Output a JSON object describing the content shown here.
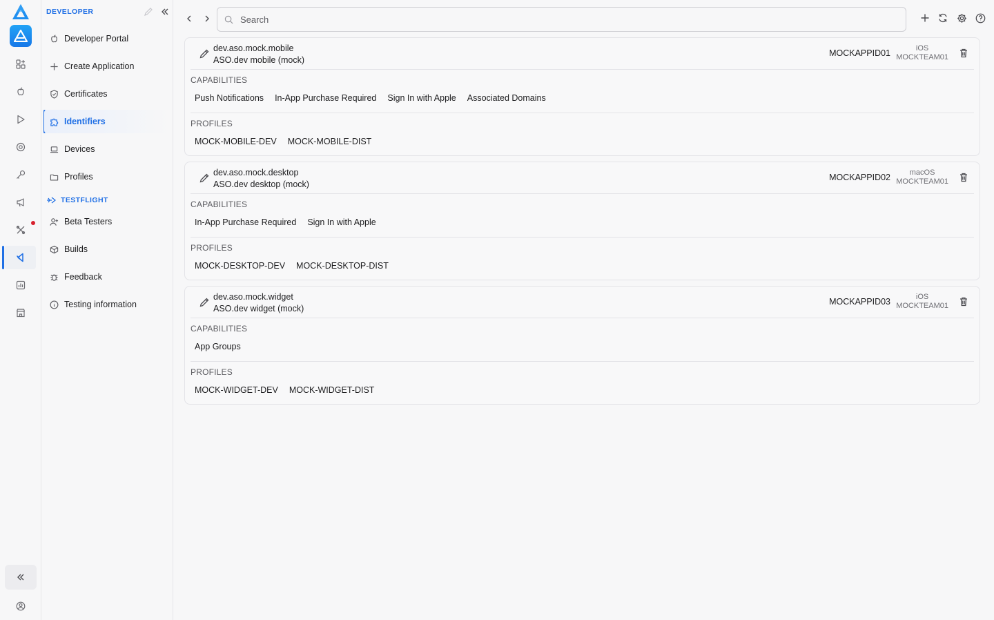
{
  "rail": {
    "icons": [
      "app-grid-icon",
      "apple-icon",
      "play-icon",
      "target-icon",
      "key-icon",
      "megaphone-icon",
      "tools-icon",
      "xcode-icon",
      "analytics-icon",
      "store-icon"
    ],
    "active_index": 7
  },
  "sidebar": {
    "developer_header": "DEVELOPER",
    "items": [
      {
        "label": "Developer Portal",
        "icon": "apple-icon"
      },
      {
        "label": "Create Application",
        "icon": "plus-icon"
      },
      {
        "label": "Certificates",
        "icon": "shield-check-icon"
      },
      {
        "label": "Identifiers",
        "icon": "puzzle-icon",
        "active": true
      },
      {
        "label": "Devices",
        "icon": "laptop-icon"
      },
      {
        "label": "Profiles",
        "icon": "folder-icon"
      }
    ],
    "testflight_header": "TESTFLIGHT",
    "testflight_items": [
      {
        "label": "Beta Testers",
        "icon": "person-add-icon"
      },
      {
        "label": "Builds",
        "icon": "box-icon"
      },
      {
        "label": "Feedback",
        "icon": "bug-icon"
      },
      {
        "label": "Testing information",
        "icon": "info-icon"
      }
    ]
  },
  "toolbar": {
    "search_placeholder": "Search"
  },
  "section_labels": {
    "capabilities": "CAPABILITIES",
    "profiles": "PROFILES"
  },
  "identifiers": [
    {
      "bundle_id": "dev.aso.mock.mobile",
      "name": "ASO.dev mobile (mock)",
      "app_id": "MOCKAPPID01",
      "platform": "iOS",
      "team": "MOCKTEAM01",
      "capabilities": [
        "Push Notifications",
        "In-App Purchase Required",
        "Sign In with Apple",
        "Associated Domains"
      ],
      "profiles": [
        "MOCK-MOBILE-DEV",
        "MOCK-MOBILE-DIST"
      ]
    },
    {
      "bundle_id": "dev.aso.mock.desktop",
      "name": "ASO.dev desktop (mock)",
      "app_id": "MOCKAPPID02",
      "platform": "macOS",
      "team": "MOCKTEAM01",
      "capabilities": [
        "In-App Purchase Required",
        "Sign In with Apple"
      ],
      "profiles": [
        "MOCK-DESKTOP-DEV",
        "MOCK-DESKTOP-DIST"
      ]
    },
    {
      "bundle_id": "dev.aso.mock.widget",
      "name": "ASO.dev widget (mock)",
      "app_id": "MOCKAPPID03",
      "platform": "iOS",
      "team": "MOCKTEAM01",
      "capabilities": [
        "App Groups"
      ],
      "profiles": [
        "MOCK-WIDGET-DEV",
        "MOCK-WIDGET-DIST"
      ]
    }
  ],
  "colors": {
    "accent": "#1f6fe5",
    "notification_dot": "#d7202d"
  }
}
